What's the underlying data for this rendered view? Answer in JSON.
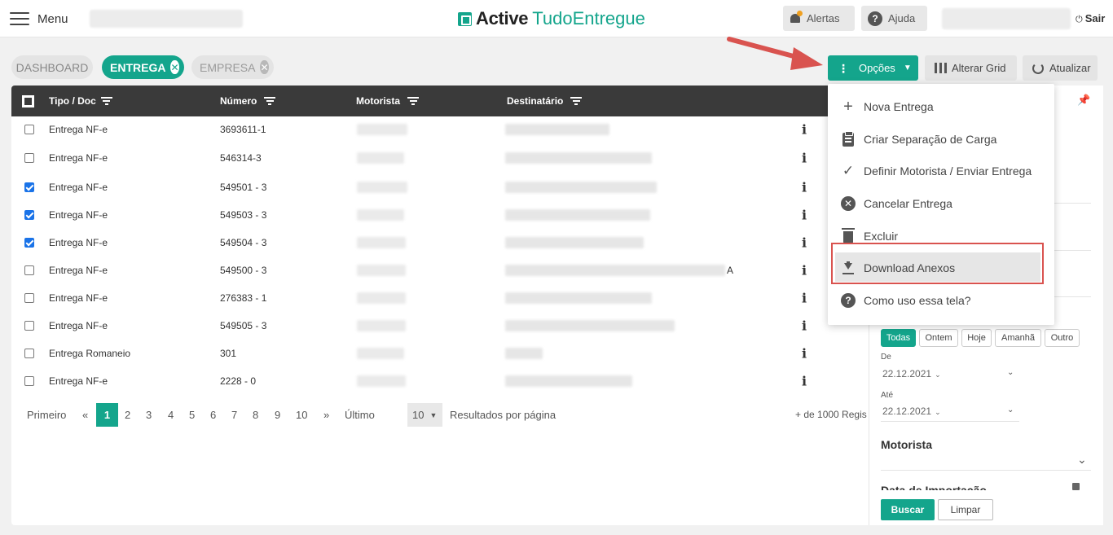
{
  "topbar": {
    "menu_label": "Menu",
    "logo_active": "Active",
    "logo_tudo": "TudoEntregue",
    "alertas": "Alertas",
    "ajuda": "Ajuda",
    "sair": "Sair"
  },
  "tabs": {
    "dashboard": "DASHBOARD",
    "entrega": "ENTREGA",
    "empresa": "EMPRESA"
  },
  "toolbar": {
    "opcoes": "Opções",
    "alterar_grid": "Alterar Grid",
    "atualizar": "Atualizar"
  },
  "table": {
    "headers": {
      "tipo": "Tipo / Doc",
      "numero": "Número",
      "motorista": "Motorista",
      "destinatario": "Destinatário"
    },
    "rows": [
      {
        "tipo": "Entrega NF-e",
        "numero": "3693611-1",
        "checked": false
      },
      {
        "tipo": "Entrega NF-e",
        "numero": "546314-3",
        "checked": false
      },
      {
        "tipo": "Entrega NF-e",
        "numero": "549501 - 3",
        "checked": true
      },
      {
        "tipo": "Entrega NF-e",
        "numero": "549503 - 3",
        "checked": true
      },
      {
        "tipo": "Entrega NF-e",
        "numero": "549504 - 3",
        "checked": true
      },
      {
        "tipo": "Entrega NF-e",
        "numero": "549500 - 3",
        "checked": false,
        "extra": "A"
      },
      {
        "tipo": "Entrega NF-e",
        "numero": "276383 - 1",
        "checked": false
      },
      {
        "tipo": "Entrega NF-e",
        "numero": "549505 - 3",
        "checked": false
      },
      {
        "tipo": "Entrega Romaneio",
        "numero": "301",
        "checked": false
      },
      {
        "tipo": "Entrega NF-e",
        "numero": "2228 - 0",
        "checked": false
      }
    ],
    "info_glyph": "i"
  },
  "pagination": {
    "primeiro": "Primeiro",
    "prev": "«",
    "pages": [
      "1",
      "2",
      "3",
      "4",
      "5",
      "6",
      "7",
      "8",
      "9",
      "10"
    ],
    "current": "1",
    "next": "»",
    "ultimo": "Último",
    "per_page": "10",
    "resultados_label": "Resultados por página",
    "total": "+ de 1000 Regis"
  },
  "dropdown": {
    "items": [
      {
        "label": "Nova Entrega",
        "icon": "plus-icon"
      },
      {
        "label": "Criar Separação de Carga",
        "icon": "clipboard-icon"
      },
      {
        "label": "Definir Motorista / Enviar Entrega",
        "icon": "check-icon"
      },
      {
        "label": "Cancelar Entrega",
        "icon": "cancel-circle-icon"
      },
      {
        "label": "Excluir",
        "icon": "trash-icon"
      },
      {
        "label": "Download Anexos",
        "icon": "download-icon"
      },
      {
        "label": "Como uso essa tela?",
        "icon": "help-icon"
      }
    ]
  },
  "filters": {
    "period_buttons": [
      "Todas",
      "Ontem",
      "Hoje",
      "Amanhã",
      "Outro"
    ],
    "de_label": "De",
    "de_value": "22.12.2021",
    "ate_label": "Até",
    "ate_value": "22.12.2021",
    "motorista_title": "Motorista",
    "data_importacao_title": "Data de Importação",
    "buscar": "Buscar",
    "limpar": "Limpar"
  },
  "colors": {
    "accent": "#14a58c",
    "header_dark": "#3a3a3a",
    "annotation_red": "#d9534f"
  }
}
